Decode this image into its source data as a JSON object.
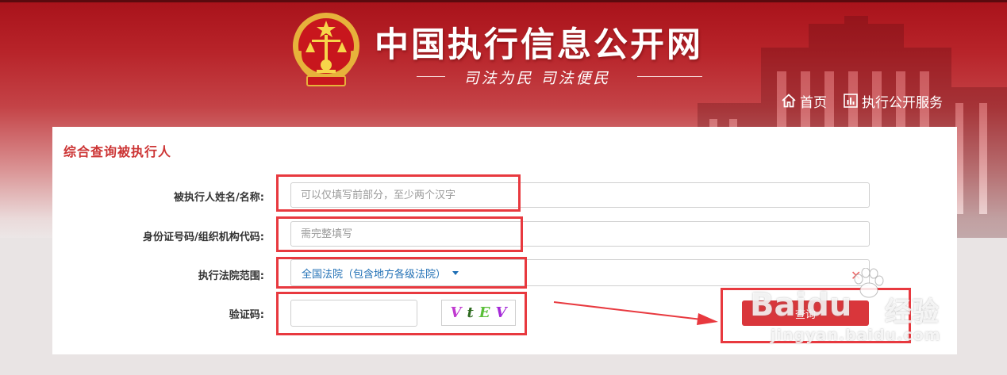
{
  "header": {
    "site_title": "中国执行信息公开网",
    "motto": "司法为民  司法便民",
    "nav": [
      {
        "label": "首页",
        "icon": "home-icon"
      },
      {
        "label": "执行公开服务",
        "icon": "bar-chart-icon"
      }
    ]
  },
  "form": {
    "title": "综合查询被执行人",
    "name_label": "被执行人姓名/名称:",
    "name_placeholder": "可以仅填写前部分，至少两个汉字",
    "name_value": "",
    "id_label": "身份证号码/组织机构代码:",
    "id_placeholder": "需完整填写",
    "id_value": "",
    "court_label": "执行法院范围:",
    "court_selected": "全国法院（包含地方各级法院）",
    "captcha_label": "验证码:",
    "captcha_value": "",
    "captcha_chars": [
      {
        "char": "V",
        "color": "#c03ad0"
      },
      {
        "char": "t",
        "color": "#2d6a1f"
      },
      {
        "char": "E",
        "color": "#5bbf3a"
      },
      {
        "char": "V",
        "color": "#a52ad8"
      }
    ],
    "submit_label": "查询"
  },
  "watermark": {
    "brand": "Baidu",
    "brand_suffix": "经验",
    "url": "jingyan.baidu.com"
  },
  "colors": {
    "brand_red": "#c33333",
    "annotation_red": "#e8393f",
    "button_red": "#d9363b",
    "link_blue": "#1f6fb5"
  }
}
